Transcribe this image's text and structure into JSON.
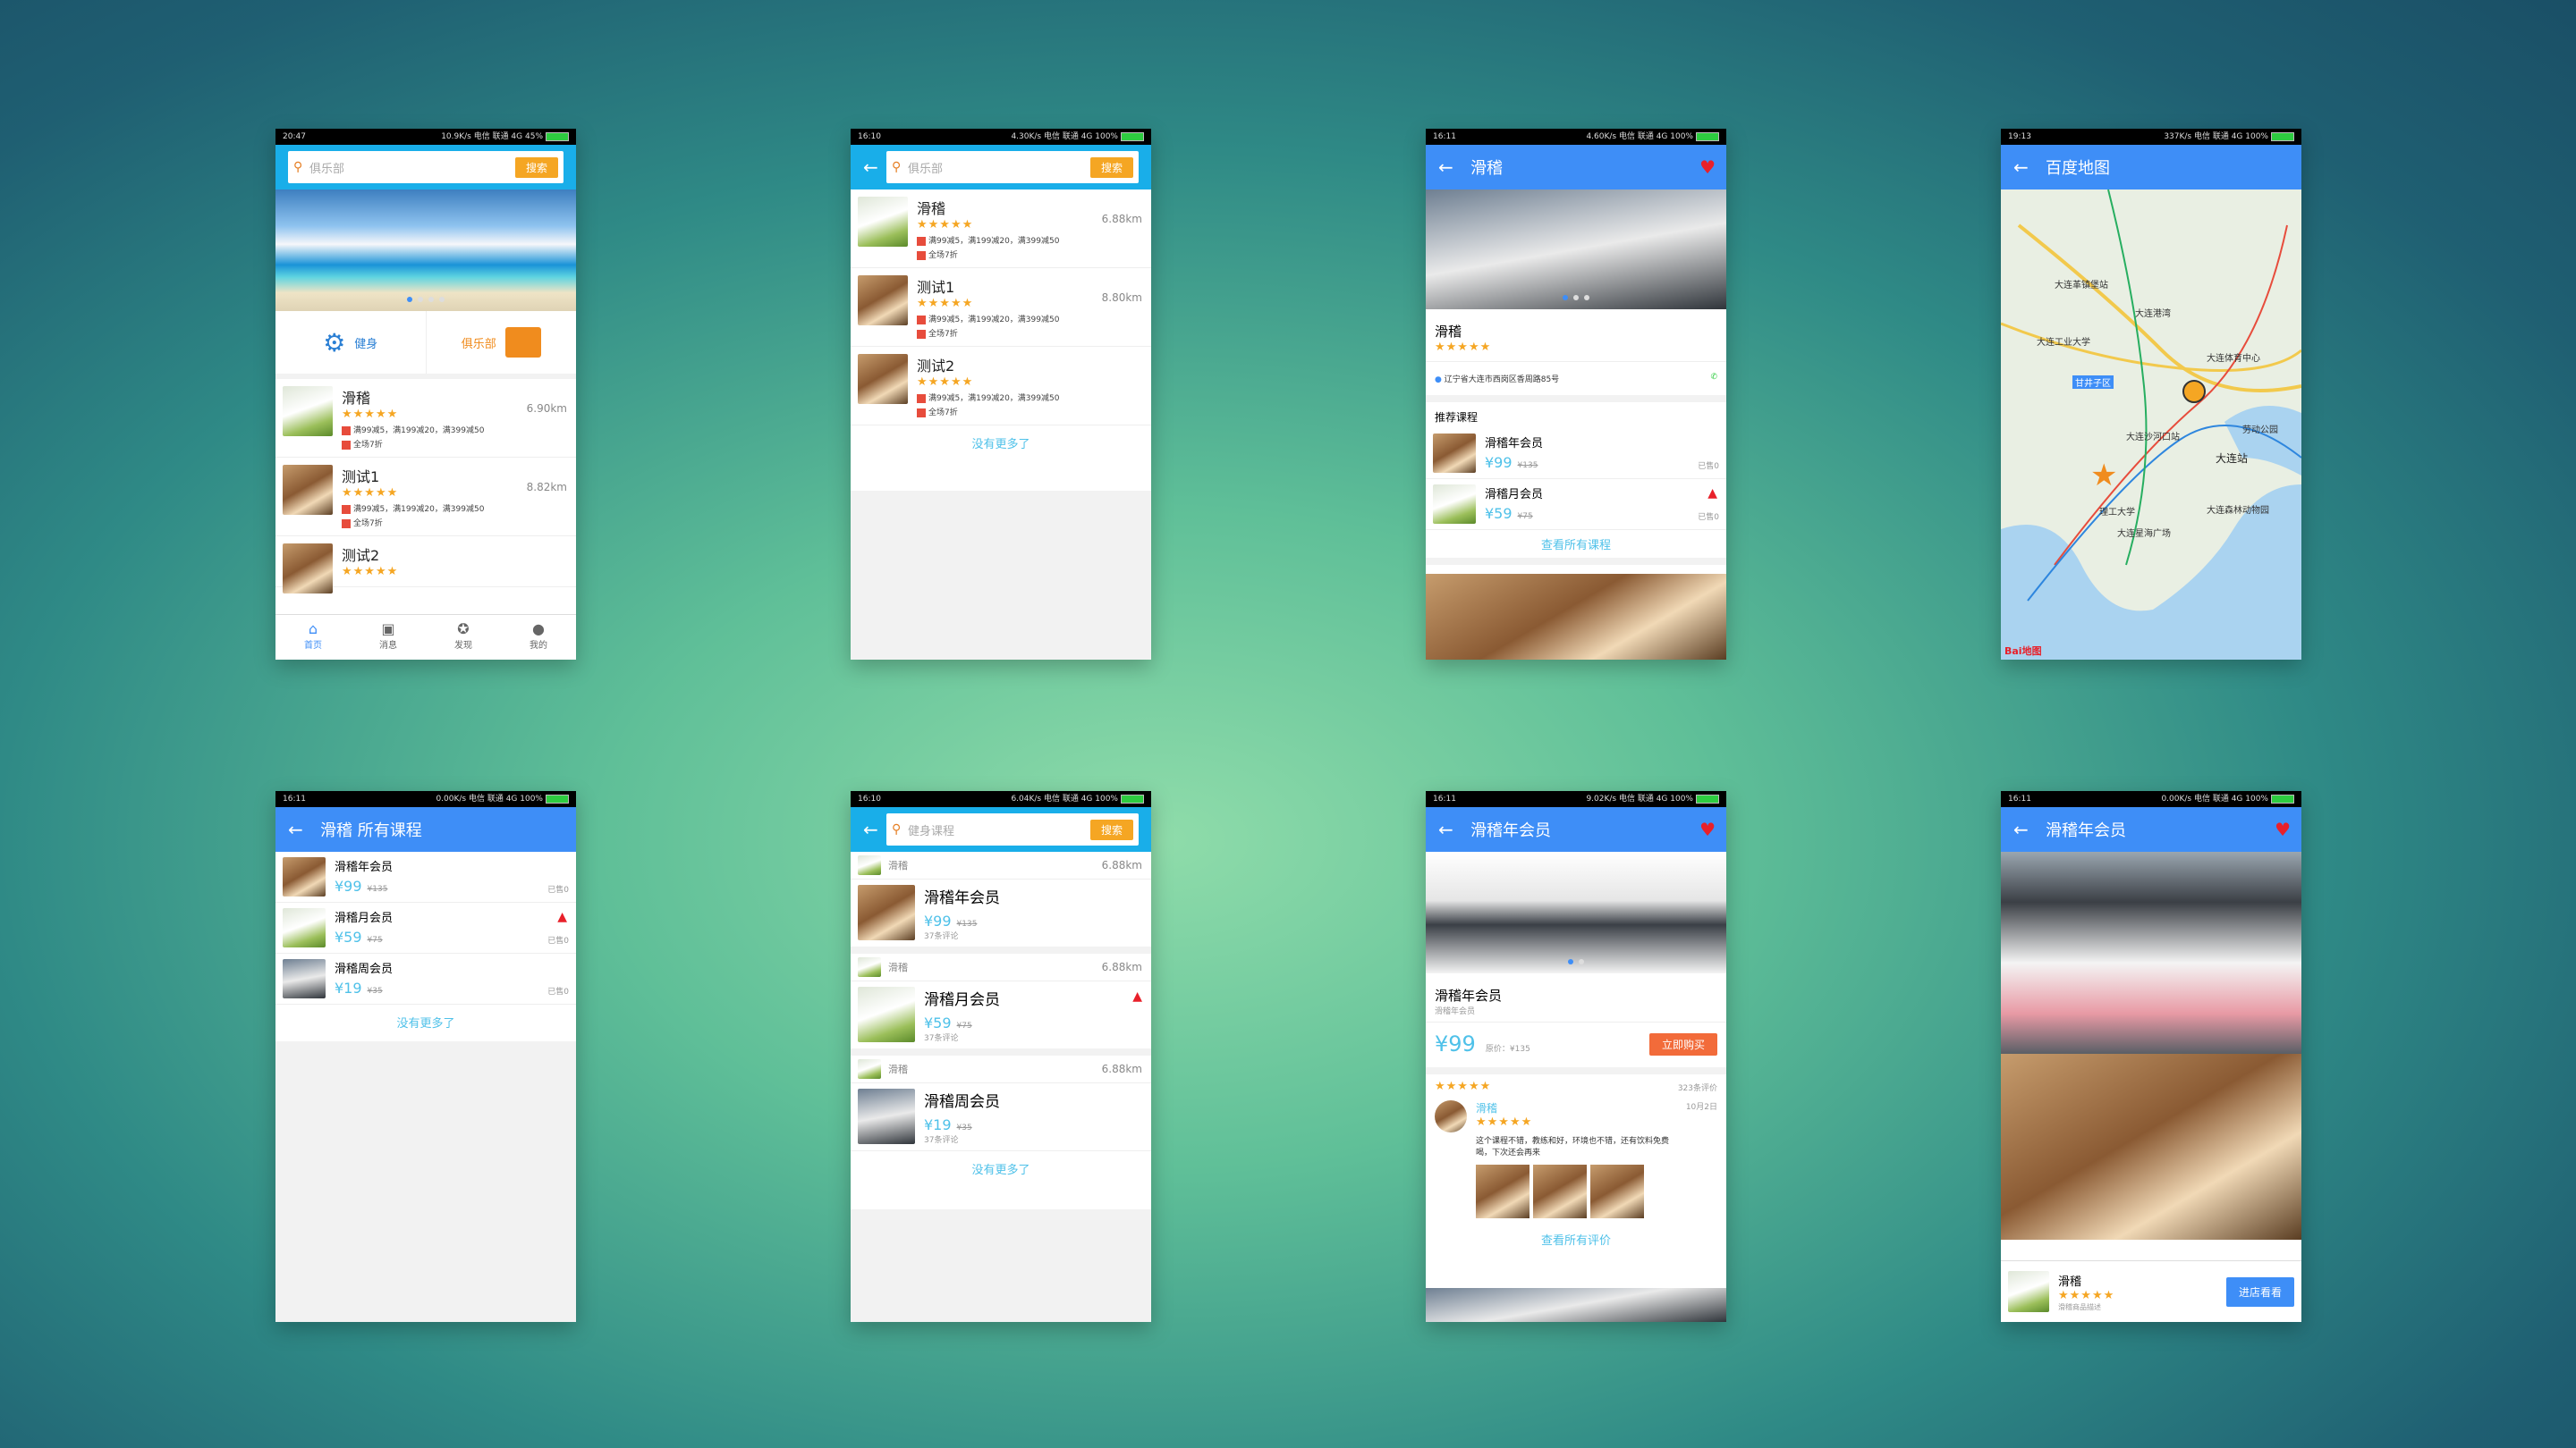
{
  "status_bars": [
    {
      "left": "20:47",
      "right": "10.9K/s  电信  联通 4G  45%"
    },
    {
      "left": "16:10",
      "right": "4.30K/s  电信  联通 4G  100%"
    },
    {
      "left": "16:11",
      "right": "4.60K/s  电信  联通 4G  100%"
    },
    {
      "left": "19:13",
      "right": "337K/s  电信  联通 4G  100%"
    },
    {
      "left": "16:11",
      "right": "0.00K/s  电信  联通 4G  100%"
    },
    {
      "left": "16:10",
      "right": "6.04K/s  电信  联通 4G  100%"
    },
    {
      "left": "16:11",
      "right": "9.02K/s  电信  联通 4G  100%"
    },
    {
      "left": "16:11",
      "right": "0.00K/s  电信  联通 4G  100%"
    }
  ],
  "screen1": {
    "search_placeholder": "俱乐部",
    "search_button": "搜索",
    "categories": [
      "健身",
      "俱乐部"
    ],
    "items": [
      {
        "name": "滑稽",
        "distance": "6.90km",
        "promo1": "满99减5，满199减20，满399减50",
        "promo2": "全场7折"
      },
      {
        "name": "测试1",
        "distance": "8.82km",
        "promo1": "满99减5，满199减20，满399减50",
        "promo2": "全场7折"
      },
      {
        "name": "测试2",
        "distance": ""
      }
    ],
    "tabs": [
      "首页",
      "消息",
      "发现",
      "我的"
    ]
  },
  "screen2": {
    "search_placeholder": "俱乐部",
    "search_button": "搜索",
    "items": [
      {
        "name": "滑稽",
        "distance": "6.88km",
        "promo1": "满99减5，满199减20，满399减50",
        "promo2": "全场7折"
      },
      {
        "name": "测试1",
        "distance": "8.80km",
        "promo1": "满99减5，满199减20，满399减50",
        "promo2": "全场7折"
      },
      {
        "name": "测试2",
        "distance": "",
        "promo1": "满99减5，满199减20，满399减50",
        "promo2": "全场7折"
      }
    ],
    "no_more": "没有更多了"
  },
  "screen3": {
    "title": "滑稽",
    "shop_name": "滑稽",
    "address": "辽宁省大连市西岗区香周路85号",
    "recommend_title": "推荐课程",
    "courses": [
      {
        "name": "滑稽年会员",
        "price": "¥99",
        "old": "¥135",
        "sold": "已售0"
      },
      {
        "name": "滑稽月会员",
        "price": "¥59",
        "old": "¥75",
        "sold": "已售0"
      }
    ],
    "view_all": "查看所有课程"
  },
  "screen4": {
    "title": "百度地图",
    "labels": [
      "大连革镇堡站",
      "大连工业大学",
      "大连港湾",
      "甘井子区",
      "大连站",
      "大连沙河口站",
      "理工大学",
      "大连星海广场",
      "大连森林动物园",
      "劳动公园",
      "大连体育中心"
    ],
    "logo": "Bai地图"
  },
  "screen5": {
    "title": "滑稽  所有课程",
    "courses": [
      {
        "name": "滑稽年会员",
        "price": "¥99",
        "old": "¥135",
        "sold": "已售0"
      },
      {
        "name": "滑稽月会员",
        "price": "¥59",
        "old": "¥75",
        "sold": "已售0"
      },
      {
        "name": "滑稽周会员",
        "price": "¥19",
        "old": "¥35",
        "sold": "已售0"
      }
    ],
    "no_more": "没有更多了"
  },
  "screen6": {
    "search_placeholder": "健身课程",
    "search_button": "搜索",
    "groups": [
      {
        "shop": "滑稽",
        "distance": "6.88km",
        "course": "滑稽年会员",
        "price": "¥99",
        "old": "¥135",
        "reviews": "37条评论"
      },
      {
        "shop": "滑稽",
        "distance": "6.88km",
        "course": "滑稽月会员",
        "price": "¥59",
        "old": "¥75",
        "reviews": "37条评论"
      },
      {
        "shop": "滑稽",
        "distance": "6.88km",
        "course": "滑稽周会员",
        "price": "¥19",
        "old": "¥35",
        "reviews": "37条评论"
      }
    ],
    "no_more": "没有更多了"
  },
  "screen7": {
    "title": "滑稽年会员",
    "course_name": "滑稽年会员",
    "sub": "滑稽年会员",
    "price": "¥99",
    "orig": "原价：¥135",
    "buy": "立即购买",
    "review_count": "323条评价",
    "reviewer": "滑稽",
    "review_date": "10月2日",
    "review_text": "这个课程不错，教练和好，环境也不错，还有饮料免费喝，下次还会再来",
    "view_all": "查看所有评价"
  },
  "screen8": {
    "title": "滑稽年会员",
    "shop": "滑稽",
    "sub": "滑稽商品描述",
    "enter": "进店看看"
  }
}
